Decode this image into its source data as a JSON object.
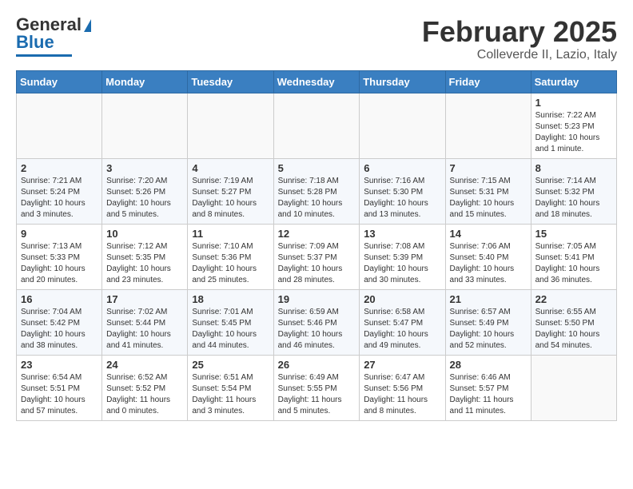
{
  "header": {
    "logo_general": "General",
    "logo_blue": "Blue",
    "month": "February 2025",
    "location": "Colleverde II, Lazio, Italy"
  },
  "weekdays": [
    "Sunday",
    "Monday",
    "Tuesday",
    "Wednesday",
    "Thursday",
    "Friday",
    "Saturday"
  ],
  "weeks": [
    [
      {
        "day": "",
        "info": ""
      },
      {
        "day": "",
        "info": ""
      },
      {
        "day": "",
        "info": ""
      },
      {
        "day": "",
        "info": ""
      },
      {
        "day": "",
        "info": ""
      },
      {
        "day": "",
        "info": ""
      },
      {
        "day": "1",
        "info": "Sunrise: 7:22 AM\nSunset: 5:23 PM\nDaylight: 10 hours\nand 1 minute."
      }
    ],
    [
      {
        "day": "2",
        "info": "Sunrise: 7:21 AM\nSunset: 5:24 PM\nDaylight: 10 hours\nand 3 minutes."
      },
      {
        "day": "3",
        "info": "Sunrise: 7:20 AM\nSunset: 5:26 PM\nDaylight: 10 hours\nand 5 minutes."
      },
      {
        "day": "4",
        "info": "Sunrise: 7:19 AM\nSunset: 5:27 PM\nDaylight: 10 hours\nand 8 minutes."
      },
      {
        "day": "5",
        "info": "Sunrise: 7:18 AM\nSunset: 5:28 PM\nDaylight: 10 hours\nand 10 minutes."
      },
      {
        "day": "6",
        "info": "Sunrise: 7:16 AM\nSunset: 5:30 PM\nDaylight: 10 hours\nand 13 minutes."
      },
      {
        "day": "7",
        "info": "Sunrise: 7:15 AM\nSunset: 5:31 PM\nDaylight: 10 hours\nand 15 minutes."
      },
      {
        "day": "8",
        "info": "Sunrise: 7:14 AM\nSunset: 5:32 PM\nDaylight: 10 hours\nand 18 minutes."
      }
    ],
    [
      {
        "day": "9",
        "info": "Sunrise: 7:13 AM\nSunset: 5:33 PM\nDaylight: 10 hours\nand 20 minutes."
      },
      {
        "day": "10",
        "info": "Sunrise: 7:12 AM\nSunset: 5:35 PM\nDaylight: 10 hours\nand 23 minutes."
      },
      {
        "day": "11",
        "info": "Sunrise: 7:10 AM\nSunset: 5:36 PM\nDaylight: 10 hours\nand 25 minutes."
      },
      {
        "day": "12",
        "info": "Sunrise: 7:09 AM\nSunset: 5:37 PM\nDaylight: 10 hours\nand 28 minutes."
      },
      {
        "day": "13",
        "info": "Sunrise: 7:08 AM\nSunset: 5:39 PM\nDaylight: 10 hours\nand 30 minutes."
      },
      {
        "day": "14",
        "info": "Sunrise: 7:06 AM\nSunset: 5:40 PM\nDaylight: 10 hours\nand 33 minutes."
      },
      {
        "day": "15",
        "info": "Sunrise: 7:05 AM\nSunset: 5:41 PM\nDaylight: 10 hours\nand 36 minutes."
      }
    ],
    [
      {
        "day": "16",
        "info": "Sunrise: 7:04 AM\nSunset: 5:42 PM\nDaylight: 10 hours\nand 38 minutes."
      },
      {
        "day": "17",
        "info": "Sunrise: 7:02 AM\nSunset: 5:44 PM\nDaylight: 10 hours\nand 41 minutes."
      },
      {
        "day": "18",
        "info": "Sunrise: 7:01 AM\nSunset: 5:45 PM\nDaylight: 10 hours\nand 44 minutes."
      },
      {
        "day": "19",
        "info": "Sunrise: 6:59 AM\nSunset: 5:46 PM\nDaylight: 10 hours\nand 46 minutes."
      },
      {
        "day": "20",
        "info": "Sunrise: 6:58 AM\nSunset: 5:47 PM\nDaylight: 10 hours\nand 49 minutes."
      },
      {
        "day": "21",
        "info": "Sunrise: 6:57 AM\nSunset: 5:49 PM\nDaylight: 10 hours\nand 52 minutes."
      },
      {
        "day": "22",
        "info": "Sunrise: 6:55 AM\nSunset: 5:50 PM\nDaylight: 10 hours\nand 54 minutes."
      }
    ],
    [
      {
        "day": "23",
        "info": "Sunrise: 6:54 AM\nSunset: 5:51 PM\nDaylight: 10 hours\nand 57 minutes."
      },
      {
        "day": "24",
        "info": "Sunrise: 6:52 AM\nSunset: 5:52 PM\nDaylight: 11 hours\nand 0 minutes."
      },
      {
        "day": "25",
        "info": "Sunrise: 6:51 AM\nSunset: 5:54 PM\nDaylight: 11 hours\nand 3 minutes."
      },
      {
        "day": "26",
        "info": "Sunrise: 6:49 AM\nSunset: 5:55 PM\nDaylight: 11 hours\nand 5 minutes."
      },
      {
        "day": "27",
        "info": "Sunrise: 6:47 AM\nSunset: 5:56 PM\nDaylight: 11 hours\nand 8 minutes."
      },
      {
        "day": "28",
        "info": "Sunrise: 6:46 AM\nSunset: 5:57 PM\nDaylight: 11 hours\nand 11 minutes."
      },
      {
        "day": "",
        "info": ""
      }
    ]
  ]
}
